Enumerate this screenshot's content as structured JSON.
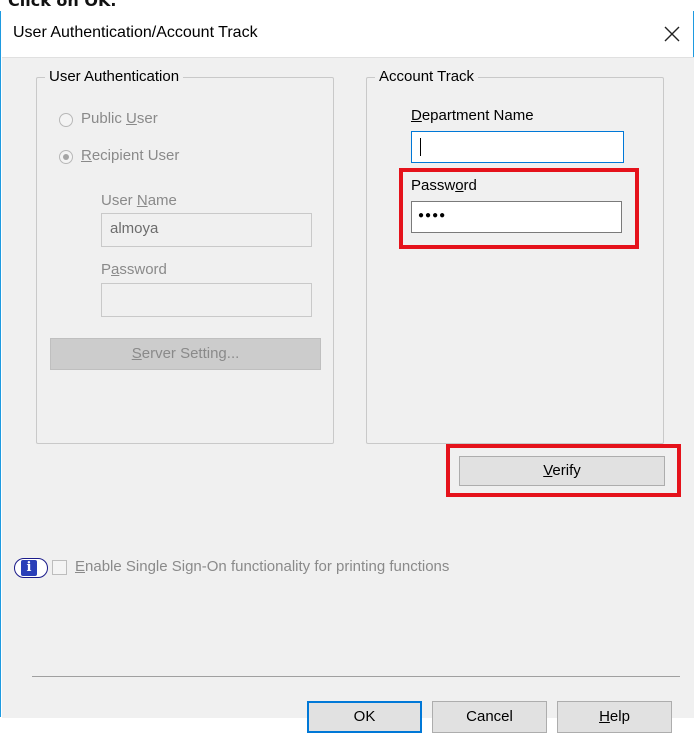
{
  "doc_caption": "Click on OK.",
  "dialog": {
    "title": "User Authentication/Account Track",
    "close_icon": "×"
  },
  "user_auth": {
    "legend": "User Authentication",
    "public_user_pre": "Public ",
    "public_user_key": "U",
    "public_user_post": "ser",
    "recipient_user_pre": "",
    "recipient_user_key": "R",
    "recipient_user_post": "ecipient User",
    "selected": "recipient",
    "user_name_label_pre": "User ",
    "user_name_label_key": "N",
    "user_name_label_post": "ame",
    "user_name_value": "almoya",
    "password_label_pre": "P",
    "password_label_key": "a",
    "password_label_post": "ssword",
    "password_value": "",
    "server_setting_pre": "",
    "server_setting_key": "S",
    "server_setting_post": "erver Setting..."
  },
  "account_track": {
    "legend": "Account Track",
    "department_label_pre": "",
    "department_label_key": "D",
    "department_label_post": "epartment Name",
    "department_value": "",
    "password_label_pre": "Passw",
    "password_label_key": "o",
    "password_label_post": "rd",
    "password_value": "●●●●"
  },
  "verify_button": {
    "key": "V",
    "post": "erify"
  },
  "sso": {
    "key": "E",
    "label_post": "nable Single Sign-On functionality for printing functions",
    "checked": false
  },
  "footer": {
    "ok_label": "OK",
    "cancel_label": "Cancel",
    "help_key": "H",
    "help_post": "elp"
  },
  "colors": {
    "highlight": "#e5121b",
    "focus_border": "#0078d7",
    "window_border": "#1e9ae0"
  },
  "icons": {
    "info": "i"
  }
}
